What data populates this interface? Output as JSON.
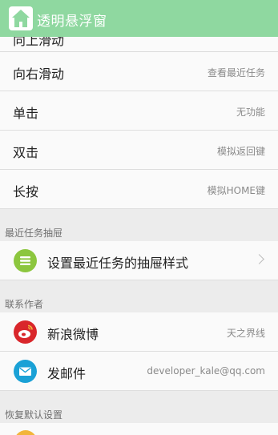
{
  "app": {
    "title": "透明悬浮窗"
  },
  "gestures": [
    {
      "label": "向右滑动",
      "value": "查看最近任务"
    },
    {
      "label": "单击",
      "value": "无功能"
    },
    {
      "label": "双击",
      "value": "模拟返回键"
    },
    {
      "label": "长按",
      "value": "模拟HOME键"
    }
  ],
  "partial_row": {
    "label": "向上滑动"
  },
  "recent": {
    "header": "最近任务抽屉",
    "style_label": "设置最近任务的抽屉样式"
  },
  "contact": {
    "header": "联系作者",
    "weibo_label": "新浪微博",
    "weibo_value": "天之界线",
    "mail_label": "发邮件",
    "mail_value": "developer_kale@qq.com"
  },
  "restore": {
    "header": "恢复默认设置"
  },
  "colors": {
    "appbar": "#8fd8a0",
    "list_icon": "#8cc63e",
    "weibo_icon": "#d9262b",
    "mail_icon": "#1aa1d6",
    "restore_icon": "#f2b53a"
  }
}
